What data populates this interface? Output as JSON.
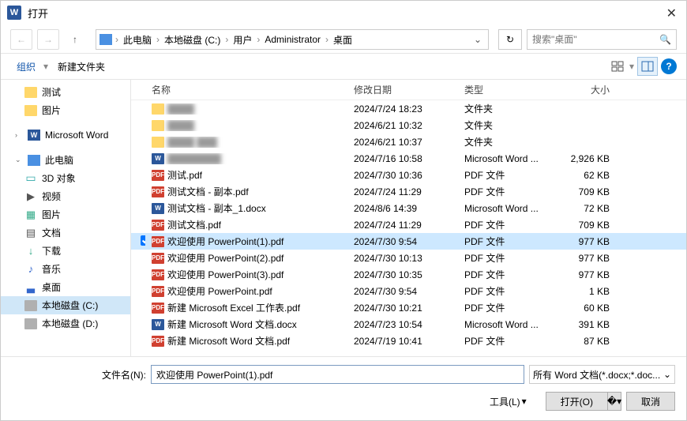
{
  "title": "打开",
  "breadcrumb": {
    "root": "此电脑",
    "parts": [
      "本地磁盘 (C:)",
      "用户",
      "Administrator",
      "桌面"
    ]
  },
  "search_placeholder": "搜索\"桌面\"",
  "toolbar": {
    "organize": "组织",
    "new_folder": "新建文件夹"
  },
  "sidebar": [
    {
      "label": "测试",
      "type": "folder",
      "lvl": "l1"
    },
    {
      "label": "图片",
      "type": "folder",
      "lvl": "l1"
    },
    {
      "label": "Microsoft Word",
      "type": "word",
      "lvl": "l0",
      "gapBefore": true
    },
    {
      "label": "此电脑",
      "type": "pc",
      "lvl": "l0",
      "exp": true,
      "gapBefore": true
    },
    {
      "label": "3D 对象",
      "type": "3d",
      "lvl": "l2"
    },
    {
      "label": "视频",
      "type": "vid",
      "lvl": "l2"
    },
    {
      "label": "图片",
      "type": "img",
      "lvl": "l2"
    },
    {
      "label": "文档",
      "type": "doc",
      "lvl": "l2"
    },
    {
      "label": "下载",
      "type": "dl",
      "lvl": "l2"
    },
    {
      "label": "音乐",
      "type": "mus",
      "lvl": "l2"
    },
    {
      "label": "桌面",
      "type": "desk",
      "lvl": "l2"
    },
    {
      "label": "本地磁盘 (C:)",
      "type": "drive",
      "lvl": "l2",
      "selected": true
    },
    {
      "label": "本地磁盘 (D:)",
      "type": "drive",
      "lvl": "l2"
    }
  ],
  "columns": {
    "name": "名称",
    "date": "修改日期",
    "type": "类型",
    "size": "大小"
  },
  "files": [
    {
      "name": "████",
      "type_lbl": "文件夹",
      "date": "2024/7/24 18:23",
      "size": "",
      "kind": "folder",
      "blur": true
    },
    {
      "name": "████",
      "type_lbl": "文件夹",
      "date": "2024/6/21 10:32",
      "size": "",
      "kind": "folder",
      "blur": true
    },
    {
      "name": "████  ███",
      "type_lbl": "文件夹",
      "date": "2024/6/21 10:37",
      "size": "",
      "kind": "folder",
      "blur": true
    },
    {
      "name": "████████",
      "type_lbl": "Microsoft Word ...",
      "date": "2024/7/16 10:58",
      "size": "2,926 KB",
      "kind": "word",
      "blur": true
    },
    {
      "name": "测试.pdf",
      "type_lbl": "PDF 文件",
      "date": "2024/7/30 10:36",
      "size": "62 KB",
      "kind": "pdf"
    },
    {
      "name": "测试文档 - 副本.pdf",
      "type_lbl": "PDF 文件",
      "date": "2024/7/24 11:29",
      "size": "709 KB",
      "kind": "pdf"
    },
    {
      "name": "测试文档 - 副本_1.docx",
      "type_lbl": "Microsoft Word ...",
      "date": "2024/8/6 14:39",
      "size": "72 KB",
      "kind": "word"
    },
    {
      "name": "测试文档.pdf",
      "type_lbl": "PDF 文件",
      "date": "2024/7/24 11:29",
      "size": "709 KB",
      "kind": "pdf"
    },
    {
      "name": "欢迎使用 PowerPoint(1).pdf",
      "type_lbl": "PDF 文件",
      "date": "2024/7/30 9:54",
      "size": "977 KB",
      "kind": "pdf",
      "selected": true
    },
    {
      "name": "欢迎使用 PowerPoint(2).pdf",
      "type_lbl": "PDF 文件",
      "date": "2024/7/30 10:13",
      "size": "977 KB",
      "kind": "pdf"
    },
    {
      "name": "欢迎使用 PowerPoint(3).pdf",
      "type_lbl": "PDF 文件",
      "date": "2024/7/30 10:35",
      "size": "977 KB",
      "kind": "pdf"
    },
    {
      "name": "欢迎使用 PowerPoint.pdf",
      "type_lbl": "PDF 文件",
      "date": "2024/7/30 9:54",
      "size": "1 KB",
      "kind": "pdf"
    },
    {
      "name": "新建 Microsoft Excel 工作表.pdf",
      "type_lbl": "PDF 文件",
      "date": "2024/7/30 10:21",
      "size": "60 KB",
      "kind": "pdf"
    },
    {
      "name": "新建 Microsoft Word 文档.docx",
      "type_lbl": "Microsoft Word ...",
      "date": "2024/7/23 10:54",
      "size": "391 KB",
      "kind": "word"
    },
    {
      "name": "新建 Microsoft Word 文档.pdf",
      "type_lbl": "PDF 文件",
      "date": "2024/7/19 10:41",
      "size": "87 KB",
      "kind": "pdf"
    }
  ],
  "footer": {
    "filename_label": "文件名(N):",
    "filename_value": "欢迎使用 PowerPoint(1).pdf",
    "filter": "所有 Word 文档(*.docx;*.doc...",
    "tools": "工具(L)",
    "open": "打开(O)",
    "cancel": "取消"
  }
}
